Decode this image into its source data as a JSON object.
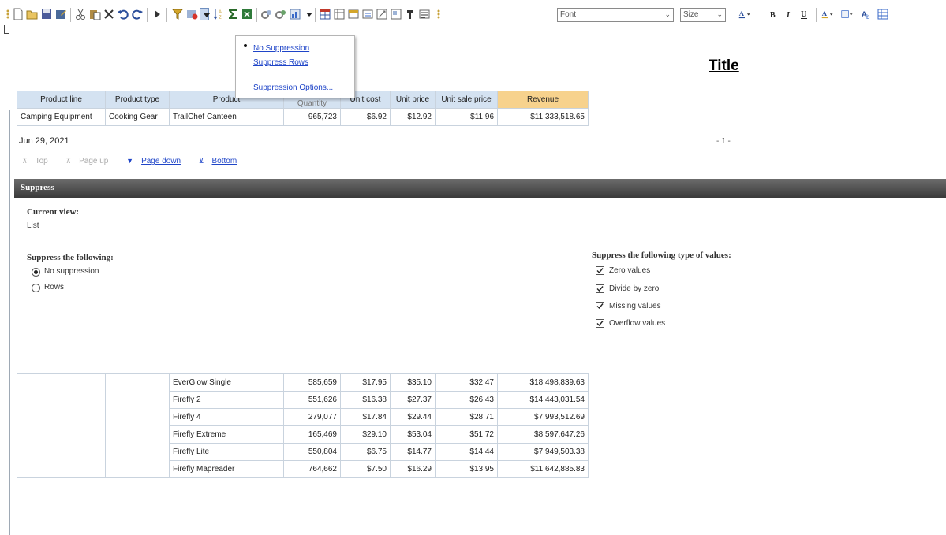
{
  "toolbar": {
    "font_select": "Font",
    "size_select": "Size",
    "icons": [
      "grip-icon",
      "new-icon",
      "open-icon",
      "save-icon",
      "save-as-icon",
      "cut-icon",
      "paste-icon",
      "delete-icon",
      "undo-icon",
      "redo-icon",
      "run-icon",
      "filter-icon",
      "suppress-icon",
      "dropdown-arrow-icon",
      "sort-icon",
      "sum-icon",
      "excel-icon",
      "group-icon",
      "ungroup-icon",
      "chart-icon",
      "more-arrow-icon",
      "table-icon",
      "crosstab-icon",
      "insert-icon",
      "swap-icon",
      "pivot-icon",
      "layout-icon",
      "section-icon",
      "format-icon",
      "font-color-icon",
      "bold-icon",
      "italic-icon",
      "underline-icon",
      "background-color-icon",
      "border-icon",
      "style-icon",
      "properties-icon"
    ]
  },
  "menu": {
    "no_suppression": "No Suppression",
    "suppress_rows": "Suppress Rows",
    "suppression_options": "Suppression Options..."
  },
  "report": {
    "title": "Title",
    "columns": [
      "Product line",
      "Product type",
      "Product",
      "Quantity",
      "Unit cost",
      "Unit price",
      "Unit sale price",
      "Revenue"
    ],
    "first_row": [
      "Camping Equipment",
      "Cooking Gear",
      "TrailChef Canteen",
      "965,723",
      "$6.92",
      "$12.92",
      "$11.96",
      "$11,333,518.65"
    ],
    "date": "Jun 29, 2021",
    "page_number": "- 1 -",
    "pager": {
      "top": "Top",
      "page_up": "Page up",
      "page_down": "Page down",
      "bottom": "Bottom"
    },
    "rows": [
      [
        "EverGlow Single",
        "585,659",
        "$17.95",
        "$35.10",
        "$32.47",
        "$18,498,839.63"
      ],
      [
        "Firefly 2",
        "551,626",
        "$16.38",
        "$27.37",
        "$26.43",
        "$14,443,031.54"
      ],
      [
        "Firefly 4",
        "279,077",
        "$17.84",
        "$29.44",
        "$28.71",
        "$7,993,512.69"
      ],
      [
        "Firefly Extreme",
        "165,469",
        "$29.10",
        "$53.04",
        "$51.72",
        "$8,597,647.26"
      ],
      [
        "Firefly Lite",
        "550,804",
        "$6.75",
        "$14.77",
        "$14.44",
        "$7,949,503.38"
      ],
      [
        "Firefly Mapreader",
        "764,662",
        "$7.50",
        "$16.29",
        "$13.95",
        "$11,642,885.83"
      ]
    ]
  },
  "suppress": {
    "header": "Suppress",
    "current_view_label": "Current view:",
    "current_view_value": "List",
    "suppress_following": "Suppress the following:",
    "options": [
      "No suppression",
      "Rows"
    ],
    "selected_option": "No suppression",
    "values_label": "Suppress the following type of values:",
    "value_types": [
      "Zero values",
      "Divide by zero",
      "Missing values",
      "Overflow values"
    ],
    "value_types_checked": [
      true,
      true,
      true,
      true
    ]
  },
  "colors": {
    "header_blue": "#d4e2f1",
    "revenue_orange": "#f7d28d",
    "link_blue": "#1f45c8",
    "panel_dark": "#3a3a3a"
  }
}
